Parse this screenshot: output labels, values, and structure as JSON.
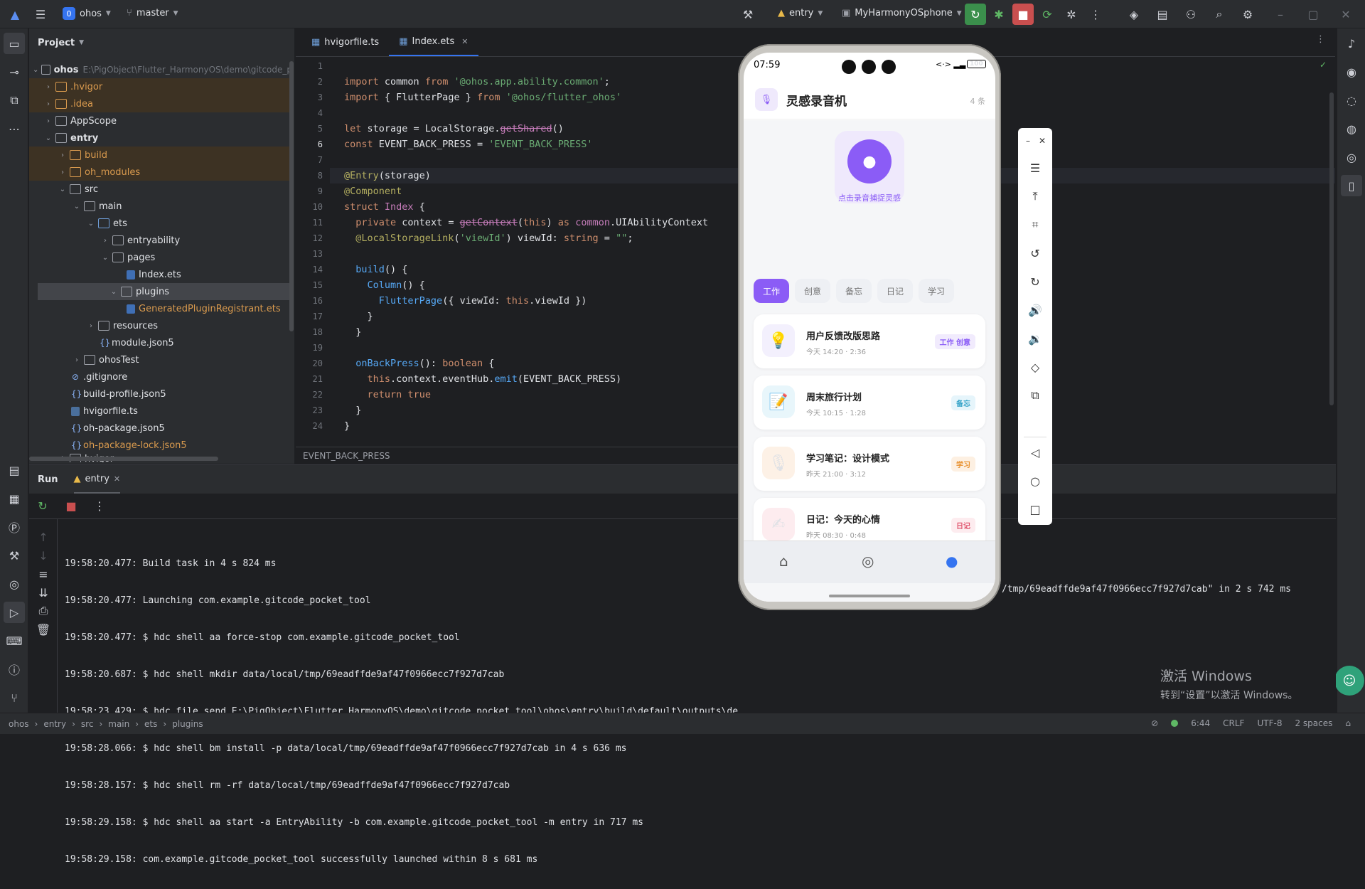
{
  "titlebar": {
    "project_badge": "0",
    "project": "ohos",
    "branch": "master",
    "run_config": "entry",
    "device": "MyHarmonyOSphone"
  },
  "project_panel": {
    "title": "Project",
    "root": "ohos",
    "root_path": "E:\\PigObject\\Flutter_HarmonyOS\\demo\\gitcode_p",
    "items": [
      {
        "label": ".hvigor"
      },
      {
        "label": ".idea"
      },
      {
        "label": "AppScope"
      },
      {
        "label": "entry"
      },
      {
        "label": "build"
      },
      {
        "label": "oh_modules"
      },
      {
        "label": "src"
      },
      {
        "label": "main"
      },
      {
        "label": "ets"
      },
      {
        "label": "entryability"
      },
      {
        "label": "pages"
      },
      {
        "label": "Index.ets"
      },
      {
        "label": "plugins"
      },
      {
        "label": "GeneratedPluginRegistrant.ets"
      },
      {
        "label": "resources"
      },
      {
        "label": "module.json5"
      },
      {
        "label": "ohosTest"
      },
      {
        "label": ".gitignore"
      },
      {
        "label": "build-profile.json5"
      },
      {
        "label": "hvigorfile.ts"
      },
      {
        "label": "oh-package.json5"
      },
      {
        "label": "oh-package-lock.json5"
      },
      {
        "label": "hvigor"
      }
    ]
  },
  "editor": {
    "tabs": [
      {
        "label": "hvigorfile.ts"
      },
      {
        "label": "Index.ets"
      }
    ],
    "line_numbers": [
      "1",
      "2",
      "3",
      "4",
      "5",
      "6",
      "7",
      "8",
      "9",
      "10",
      "11",
      "12",
      "13",
      "14",
      "15",
      "16",
      "17",
      "18",
      "19",
      "20",
      "21",
      "22",
      "23",
      "24"
    ],
    "breadcrumb": "EVENT_BACK_PRESS"
  },
  "run_panel": {
    "title": "Run",
    "tab": "entry",
    "lines": [
      "19:58:20.477: Build task in 4 s 824 ms",
      "19:58:20.477: Launching com.example.gitcode_pocket_tool",
      "19:58:20.477: $ hdc shell aa force-stop com.example.gitcode_pocket_tool",
      "19:58:20.687: $ hdc shell mkdir data/local/tmp/69eadffde9af47f0966ecc7f927d7cab",
      "19:58:23.429: $ hdc file send E:\\PigObject\\Flutter_HarmonyOS\\demo\\gitcode_pocket_tool\\ohos\\entry\\build\\default\\outputs\\de",
      "19:58:28.066: $ hdc shell bm install -p data/local/tmp/69eadffde9af47f0966ecc7f927d7cab in 4 s 636 ms",
      "19:58:28.157: $ hdc shell rm -rf data/local/tmp/69eadffde9af47f0966ecc7f927d7cab",
      "19:58:29.158: $ hdc shell aa start -a EntryAbility -b com.example.gitcode_pocket_tool -m entry in 717 ms",
      "19:58:29.158: com.example.gitcode_pocket_tool successfully launched within 8 s 681 ms"
    ],
    "tail": "/tmp/69eadffde9af47f0966ecc7f927d7cab\" in 2 s 742 ms"
  },
  "statusbar": {
    "path": [
      "ohos",
      "entry",
      "src",
      "main",
      "ets",
      "plugins"
    ],
    "position": "6:44",
    "line_sep": "CRLF",
    "encoding": "UTF-8",
    "indent": "2 spaces"
  },
  "phone": {
    "time": "07:59",
    "battery": "100",
    "app_title": "灵感录音机",
    "count": "4 条",
    "record_hint": "点击录音捕捉灵感",
    "chips": [
      "工作",
      "创意",
      "备忘",
      "日记",
      "学习"
    ],
    "cards": [
      {
        "icon": "💡",
        "title": "用户反馈改版思路",
        "meta": "今天 14:20 · 2:36",
        "tag": "工作 创意"
      },
      {
        "icon": "📝",
        "title": "周末旅行计划",
        "meta": "今天 10:15 · 1:28",
        "tag": "备忘"
      },
      {
        "icon": "🎙",
        "title": "学习笔记：设计模式",
        "meta": "昨天 21:00 · 3:12",
        "tag": "学习"
      },
      {
        "icon": "✍",
        "title": "日记：今天的心情",
        "meta": "昨天 08:30 · 0:48",
        "tag": "日记"
      }
    ]
  },
  "watermark": {
    "line1": "激活 Windows",
    "line2": "转到“设置”以激活 Windows。"
  },
  "colors": {
    "accent": "#3574f0",
    "app_purple": "#8b5cf6"
  }
}
